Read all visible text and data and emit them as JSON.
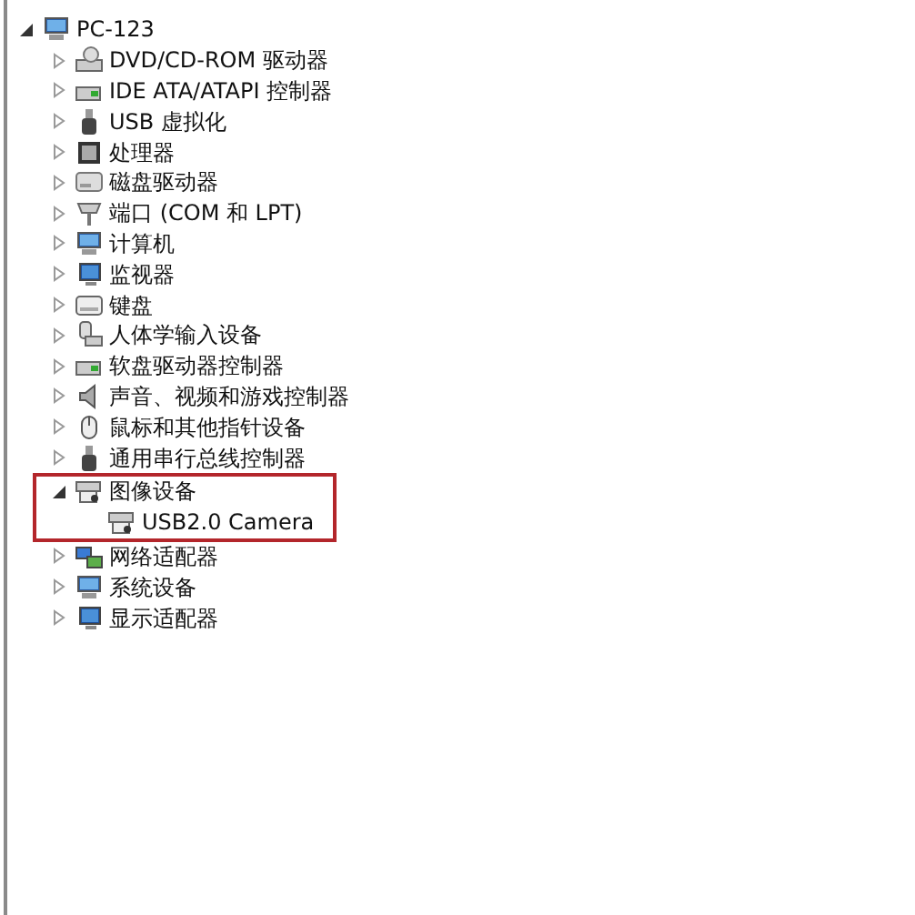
{
  "tree": {
    "label": "PC-123",
    "kind": "computer",
    "expanded": true,
    "children": [
      {
        "label": "DVD/CD-ROM 驱动器",
        "kind": "dvd",
        "expanded": false,
        "highlighted": false
      },
      {
        "label": "IDE ATA/ATAPI 控制器",
        "kind": "controller",
        "expanded": false,
        "highlighted": false
      },
      {
        "label": "USB 虚拟化",
        "kind": "usb",
        "expanded": false,
        "highlighted": false
      },
      {
        "label": "处理器",
        "kind": "cpu",
        "expanded": false,
        "highlighted": false
      },
      {
        "label": "磁盘驱动器",
        "kind": "disk",
        "expanded": false,
        "highlighted": false
      },
      {
        "label": "端口 (COM 和 LPT)",
        "kind": "port",
        "expanded": false,
        "highlighted": false
      },
      {
        "label": "计算机",
        "kind": "computer",
        "expanded": false,
        "highlighted": false
      },
      {
        "label": "监视器",
        "kind": "monitor",
        "expanded": false,
        "highlighted": false
      },
      {
        "label": "键盘",
        "kind": "keyboard",
        "expanded": false,
        "highlighted": false
      },
      {
        "label": "人体学输入设备",
        "kind": "hid",
        "expanded": false,
        "highlighted": false
      },
      {
        "label": "软盘驱动器控制器",
        "kind": "controller",
        "expanded": false,
        "highlighted": false
      },
      {
        "label": "声音、视频和游戏控制器",
        "kind": "sound",
        "expanded": false,
        "highlighted": false
      },
      {
        "label": "鼠标和其他指针设备",
        "kind": "mouse",
        "expanded": false,
        "highlighted": false
      },
      {
        "label": "通用串行总线控制器",
        "kind": "usb",
        "expanded": false,
        "highlighted": false
      },
      {
        "label": "图像设备",
        "kind": "camera",
        "expanded": true,
        "highlighted": true,
        "children": [
          {
            "label": "USB2.0 Camera",
            "kind": "camera"
          }
        ]
      },
      {
        "label": "网络适配器",
        "kind": "network",
        "expanded": false,
        "highlighted": false
      },
      {
        "label": "系统设备",
        "kind": "computer",
        "expanded": false,
        "highlighted": false
      },
      {
        "label": "显示适配器",
        "kind": "monitor",
        "expanded": false,
        "highlighted": false
      }
    ]
  }
}
